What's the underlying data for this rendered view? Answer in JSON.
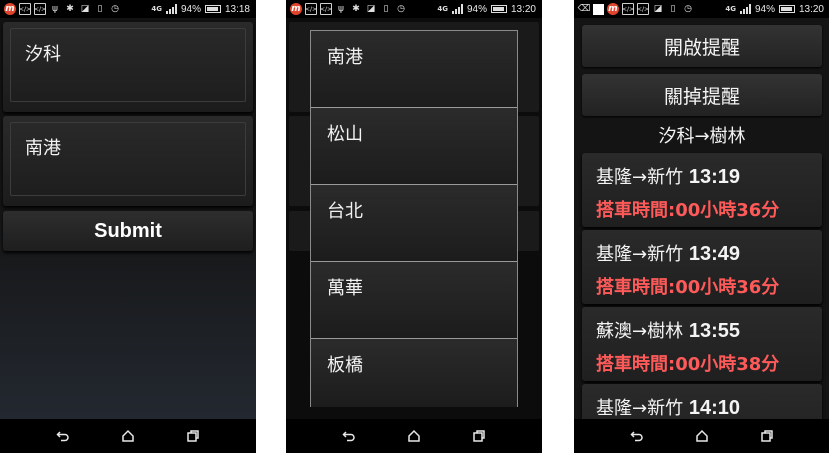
{
  "status_bars": [
    {
      "battery": "94%",
      "time": "13:18",
      "network": "4G"
    },
    {
      "battery": "94%",
      "time": "13:20",
      "network": "4G"
    },
    {
      "battery": "94%",
      "time": "13:20",
      "network": "4G"
    }
  ],
  "screen1": {
    "from_station": "汐科",
    "to_station": "南港",
    "submit_label": "Submit"
  },
  "screen2": {
    "dropdown_options": [
      "南港",
      "松山",
      "台北",
      "萬華",
      "板橋"
    ]
  },
  "screen3": {
    "enable_reminder_label": "開啟提醒",
    "disable_reminder_label": "關掉提醒",
    "route_title": "汐科→樹林",
    "trips": [
      {
        "route": "基隆→新竹",
        "time": "13:19",
        "duration": "搭車時間:00小時36分"
      },
      {
        "route": "基隆→新竹",
        "time": "13:49",
        "duration": "搭車時間:00小時36分"
      },
      {
        "route": "蘇澳→樹林",
        "time": "13:55",
        "duration": "搭車時間:00小時38分"
      },
      {
        "route": "基隆→新竹",
        "time": "14:10",
        "duration": ""
      }
    ]
  },
  "colors": {
    "duration_red": "#ff5a5a",
    "app_logo": "#e2452e"
  }
}
